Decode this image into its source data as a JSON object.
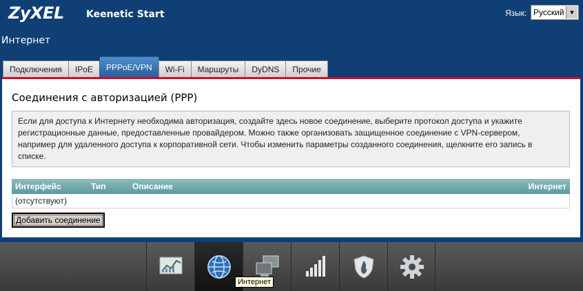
{
  "brand": {
    "logo": "ZyXEL",
    "product": "Keenetic Start"
  },
  "language": {
    "label": "Язык:",
    "selected": "Русский"
  },
  "page_title": "Интернет",
  "tabs": [
    {
      "label": "Подключения"
    },
    {
      "label": "IPoE"
    },
    {
      "label": "PPPoE/VPN",
      "active": true
    },
    {
      "label": "Wi-Fi"
    },
    {
      "label": "Маршруты"
    },
    {
      "label": "DyDNS"
    },
    {
      "label": "Прочие"
    }
  ],
  "section": {
    "title": "Соединения с авторизацией (PPP)",
    "info_lines": [
      "Если для доступа к Интернету необходима авторизация, создайте здесь новое соединение, выберите протокол доступа и укажите",
      "регистрационные данные, предоставленные провайдером. Можно также организовать защищенное соединение с VPN-сервером,",
      "например для удаленного доступа к корпоративной сети. Чтобы изменить параметры созданного соединения, щелкните его запись в",
      "списке."
    ]
  },
  "table": {
    "headers": [
      "Интерфейс",
      "Тип",
      "Описание",
      "Интернет"
    ],
    "empty_text": "(отсутствуют)"
  },
  "add_button": "Добавить соединение",
  "dock": {
    "items": [
      {
        "icon": "monitor-chart-icon"
      },
      {
        "icon": "globe-icon",
        "active": true
      },
      {
        "icon": "network-computers-icon"
      },
      {
        "icon": "wifi-signal-icon"
      },
      {
        "icon": "shield-icon"
      },
      {
        "icon": "gear-icon"
      }
    ],
    "tooltip": "Интернет"
  }
}
